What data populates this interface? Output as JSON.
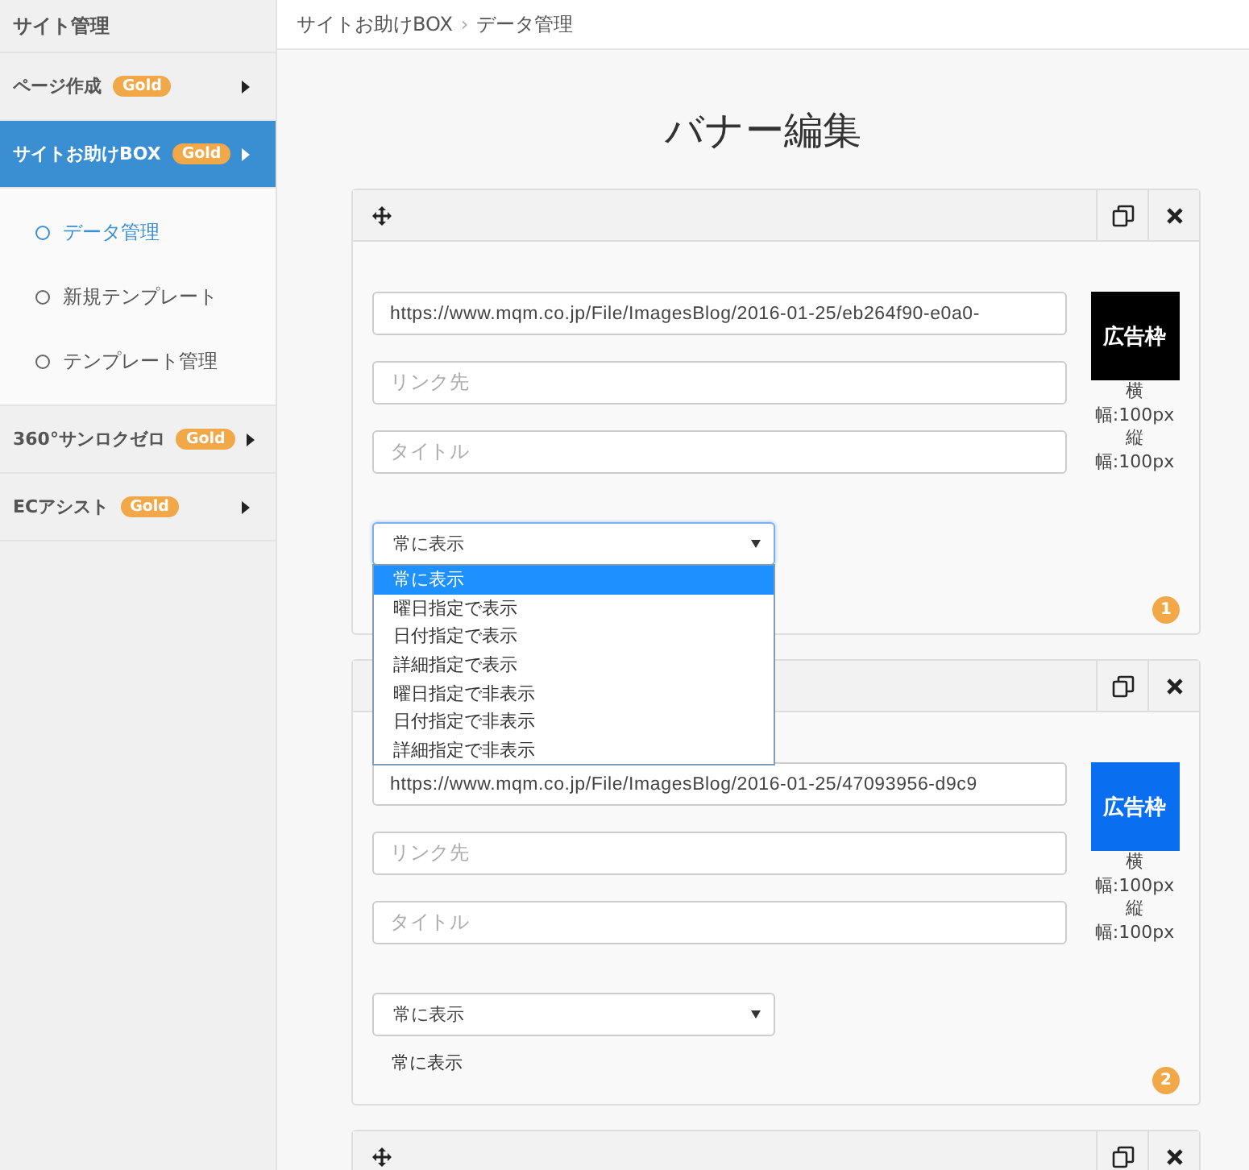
{
  "sidebar": {
    "title": "サイト管理",
    "items": [
      {
        "label": "ページ作成",
        "badge": "Gold",
        "selected": false
      },
      {
        "label": "サイトお助けBOX",
        "badge": "Gold",
        "selected": true,
        "children": [
          {
            "label": "データ管理",
            "selected": true
          },
          {
            "label": "新規テンプレート",
            "selected": false
          },
          {
            "label": "テンプレート管理",
            "selected": false
          }
        ]
      },
      {
        "label": "360°サンロクゼロ",
        "badge": "Gold",
        "selected": false
      },
      {
        "label": "ECアシスト",
        "badge": "Gold",
        "selected": false
      }
    ]
  },
  "breadcrumb": {
    "separator": "›",
    "items": [
      "サイトお助けBOX",
      "データ管理"
    ]
  },
  "page_title": "バナー編集",
  "banners": [
    {
      "kind": "full",
      "image_url": "https://www.mqm.co.jp/File/ImagesBlog/2016-01-25/eb264f90-e0a0-",
      "link_placeholder": "リンク先",
      "title_placeholder": "タイトル",
      "thumbnail": {
        "label": "広告枠",
        "color": "#000000"
      },
      "size_lines": [
        "横",
        "幅:100px",
        "縦",
        "幅:100px"
      ],
      "display": "常に表示",
      "dropdown": {
        "open": true,
        "options": [
          {
            "label": "常に表示",
            "selected": true
          },
          {
            "label": "曜日指定で表示",
            "selected": false
          },
          {
            "label": "日付指定で表示",
            "selected": false
          },
          {
            "label": "詳細指定で表示",
            "selected": false
          },
          {
            "label": "曜日指定で非表示",
            "selected": false
          },
          {
            "label": "日付指定で非表示",
            "selected": false
          },
          {
            "label": "詳細指定で非表示",
            "selected": false
          }
        ]
      },
      "number": "1"
    },
    {
      "kind": "full",
      "image_url": "https://www.mqm.co.jp/File/ImagesBlog/2016-01-25/47093956-d9c9",
      "link_placeholder": "リンク先",
      "title_placeholder": "タイトル",
      "thumbnail": {
        "label": "広告枠",
        "color": "#0a6ef0"
      },
      "size_lines": [
        "横",
        "幅:100px",
        "縦",
        "幅:100px"
      ],
      "display": "常に表示",
      "status_text": "常に表示",
      "number": "2"
    },
    {
      "kind": "header"
    }
  ]
}
